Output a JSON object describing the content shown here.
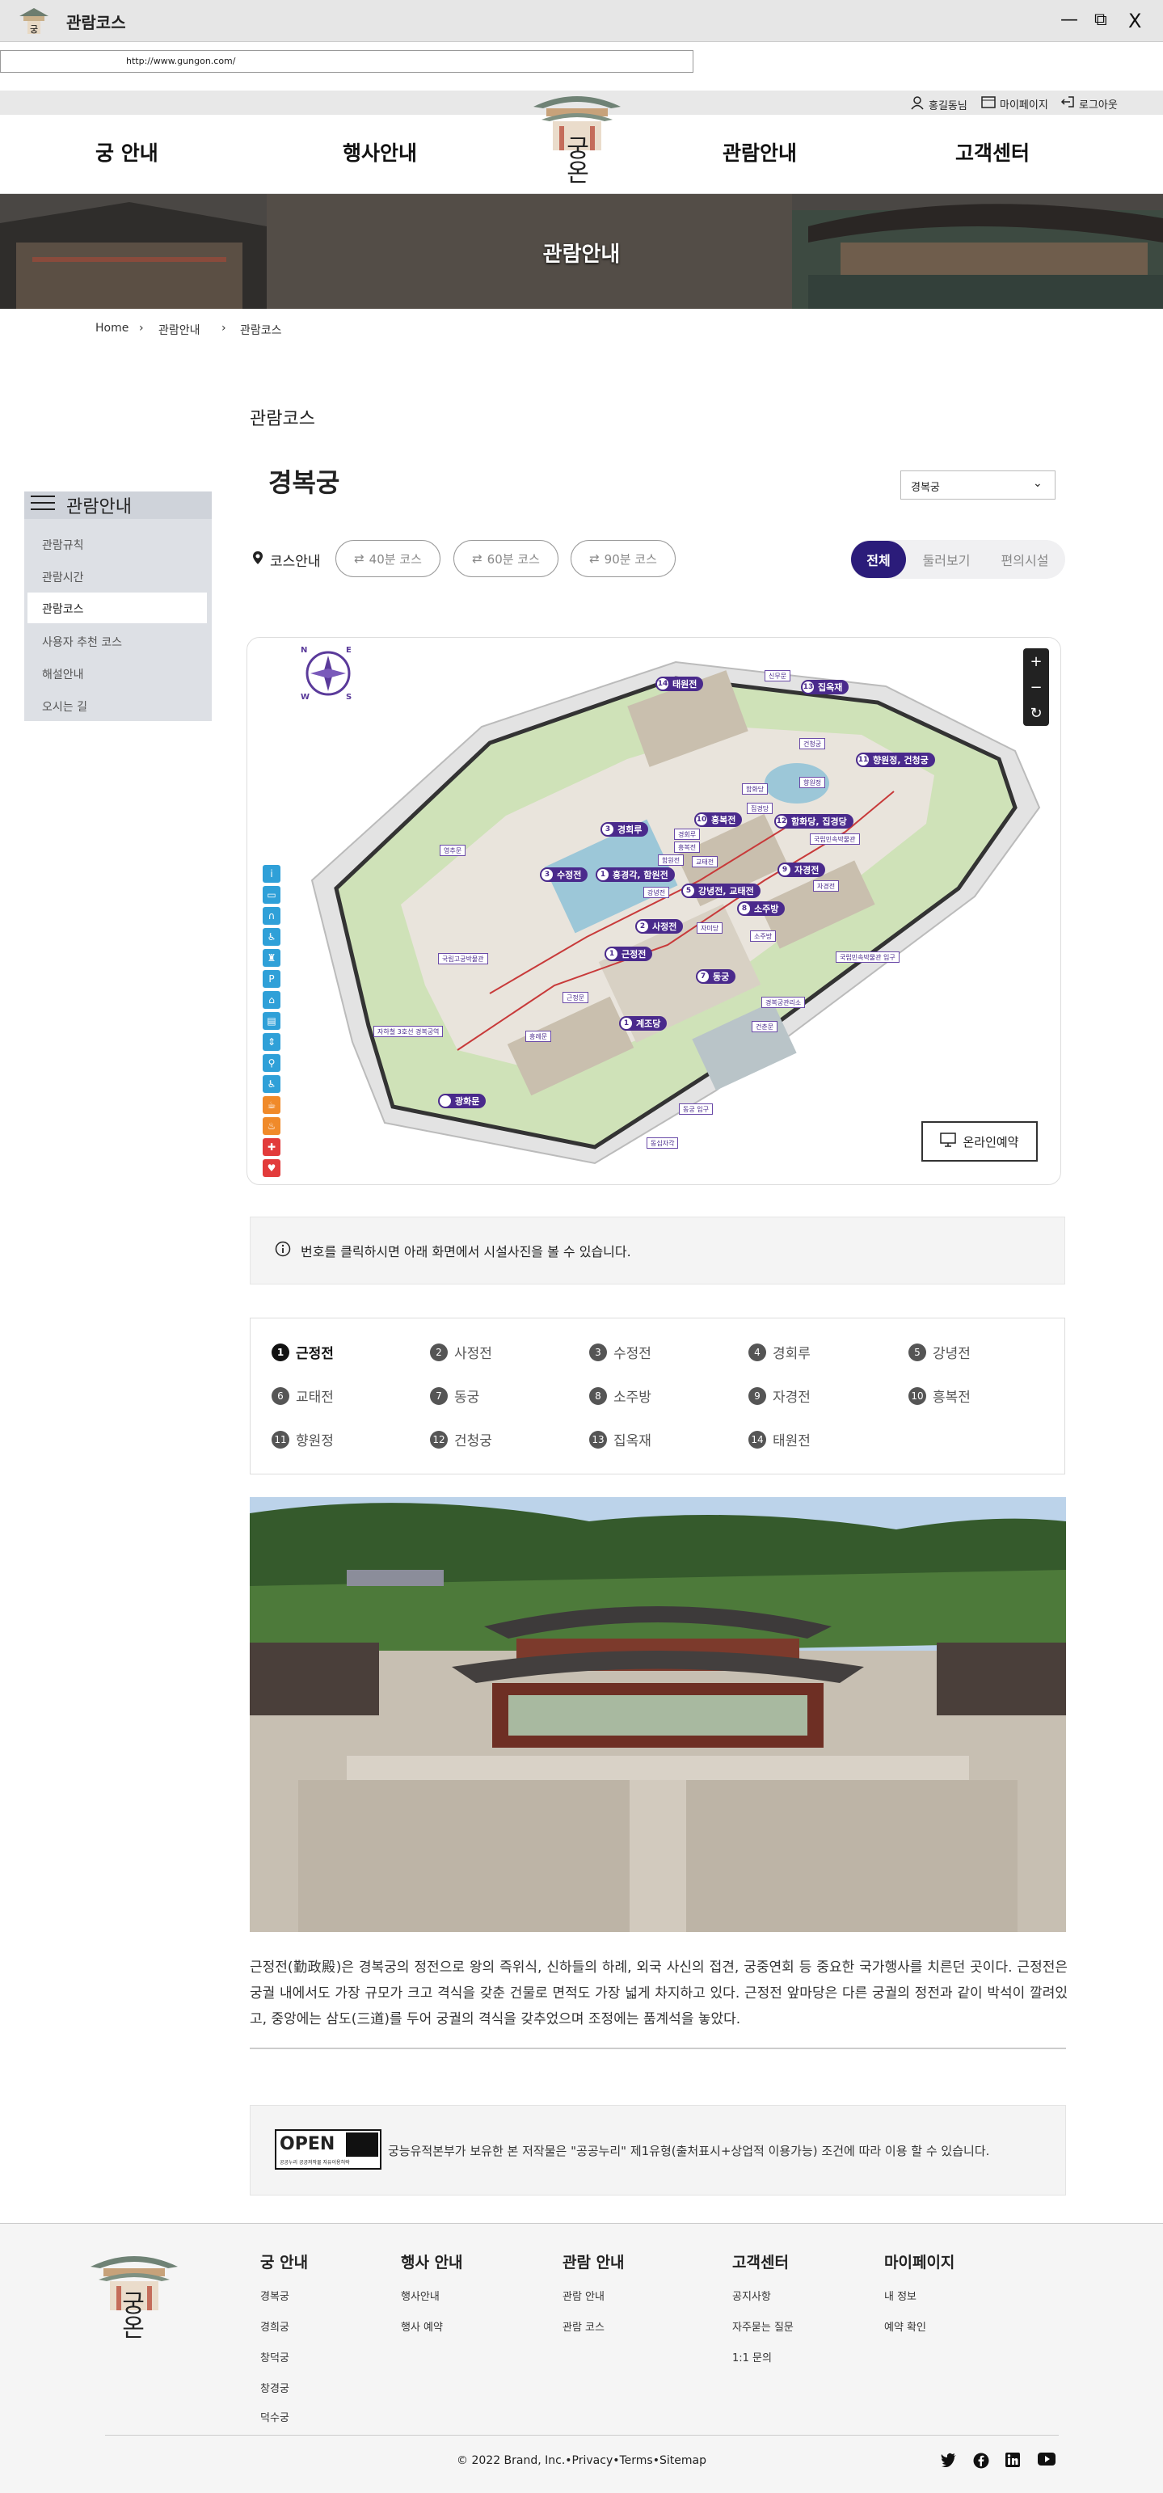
{
  "window": {
    "title": "관람코스",
    "minimize": "—",
    "restore": "⧉",
    "close": "X"
  },
  "browser": {
    "url": "http://www.gungon.com/"
  },
  "util": {
    "user": "홍길동님",
    "mypage": "마이페이지",
    "logout": "로그아웃"
  },
  "nav": {
    "items": [
      "궁 안내",
      "행사안내",
      "관람안내",
      "고객센터"
    ],
    "logo_text": "궁온"
  },
  "hero": {
    "title": "관람안내"
  },
  "breadcrumb": [
    "Home",
    "관람안내",
    "관람코스"
  ],
  "page": {
    "title": "관람코스",
    "palace": "경복궁",
    "select_value": "경복궁"
  },
  "sidebar": {
    "title": "관람안내",
    "items": [
      "관람규칙",
      "관람시간",
      "관람코스",
      "사용자 추천 코스",
      "해설안내",
      "오시는 길"
    ],
    "active_index": 2
  },
  "course": {
    "label": "코스안내",
    "pills": [
      "40분 코스",
      "60분 코스",
      "90분 코스"
    ],
    "segments": [
      "전체",
      "둘러보기",
      "편의시설"
    ]
  },
  "map": {
    "compass": [
      "N",
      "E",
      "S",
      "W"
    ],
    "zoom": [
      "+",
      "−",
      "↻"
    ],
    "reserve_label": "온라인예약",
    "pins": [
      {
        "n": "14",
        "label": "태원전"
      },
      {
        "n": "13",
        "label": "집옥재"
      },
      {
        "n": "11",
        "label": "향원정, 건청궁"
      },
      {
        "n": "3",
        "label": "경회루"
      },
      {
        "n": "10",
        "label": "흥복전"
      },
      {
        "n": "12",
        "label": "함화당, 집경당"
      },
      {
        "n": "9",
        "label": "자경전"
      },
      {
        "n": "3",
        "label": "수정전"
      },
      {
        "n": "1",
        "label": "흥경각, 함원전"
      },
      {
        "n": "5",
        "label": "강녕전, 교태전"
      },
      {
        "n": "8",
        "label": "소주방"
      },
      {
        "n": "2",
        "label": "사정전"
      },
      {
        "n": "1",
        "label": "근정전"
      },
      {
        "n": "7",
        "label": "동궁"
      },
      {
        "n": "1",
        "label": "계조당"
      },
      {
        "n": "",
        "label": "광화문"
      }
    ],
    "tags": [
      "신무문",
      "향원정",
      "건청궁",
      "집경당",
      "함화당",
      "국립민속박물관",
      "흥복전",
      "교태전",
      "함원전",
      "경회루",
      "강녕전",
      "영추문",
      "자경전",
      "자미당",
      "소주방",
      "국립고궁박물관",
      "근정문",
      "국립민속박물관 입구",
      "경복궁관리소",
      "흥례문",
      "자하철 3호선 경복궁역",
      "건춘문",
      "동궁 입구",
      "동십자각"
    ]
  },
  "info": {
    "text": "번호를 클릭하시면 아래 화면에서 시설사진을 볼 수 있습니다."
  },
  "numbers": [
    {
      "n": "1",
      "label": "근정전"
    },
    {
      "n": "2",
      "label": "사정전"
    },
    {
      "n": "3",
      "label": "수정전"
    },
    {
      "n": "4",
      "label": "경회루"
    },
    {
      "n": "5",
      "label": "강녕전"
    },
    {
      "n": "6",
      "label": "교태전"
    },
    {
      "n": "7",
      "label": "동궁"
    },
    {
      "n": "8",
      "label": "소주방"
    },
    {
      "n": "9",
      "label": "자경전"
    },
    {
      "n": "10",
      "label": "흥복전"
    },
    {
      "n": "11",
      "label": "향원정"
    },
    {
      "n": "12",
      "label": "건청궁"
    },
    {
      "n": "13",
      "label": "집옥재"
    },
    {
      "n": "14",
      "label": "태원전"
    }
  ],
  "description": "근정전(勤政殿)은 경복궁의 정전으로 왕의 즉위식, 신하들의 하례, 외국 사신의 접견, 궁중연회 등 중요한 국가행사를 치른던 곳이다. 근정전은 궁궐 내에서도 가장 규모가 크고 격식을 갖춘 건물로 면적도 가장 넓게 차지하고 있다. 근정전 앞마당은 다른 궁궐의 정전과 같이 박석이 깔려있고, 중앙에는 삼도(三道)를 두어 궁궐의 격식을 갖추었으며 조정에는 품계석을 놓았다.",
  "open": {
    "logo": "OPEN",
    "logo_sub": "공공누리 공공저작물 자유이용허락",
    "text": "궁능유적본부가 보유한 본 저작물은 \"공공누리\" 제1유형(출처표시+상업적 이용가능) 조건에 따라 이용 할 수 있습니다."
  },
  "footer": {
    "cols": [
      {
        "h": "궁 안내",
        "links": [
          "경복궁",
          "경희궁",
          "창덕궁",
          "창경궁",
          "덕수궁"
        ]
      },
      {
        "h": "행사 안내",
        "links": [
          "행사안내",
          "행사 예약"
        ]
      },
      {
        "h": "관람 안내",
        "links": [
          "관람 안내",
          "관람 코스"
        ]
      },
      {
        "h": "고객센터",
        "links": [
          "공지사항",
          "자주묻는 질문",
          "1:1 문의"
        ]
      },
      {
        "h": "마이페이지",
        "links": [
          "내 정보",
          "예약 확인"
        ]
      }
    ],
    "copyright": "© 2022 Brand, Inc.•Privacy•Terms•Sitemap"
  },
  "colors": {
    "accent": "#2b1c7a",
    "pin": "#4a2a8c"
  }
}
